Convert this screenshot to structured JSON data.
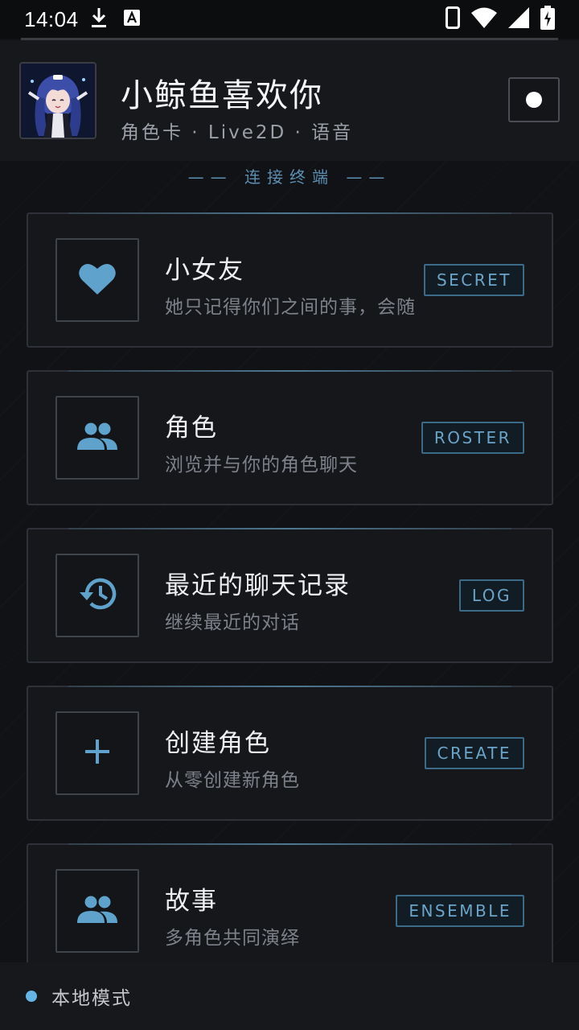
{
  "status_bar": {
    "time": "14:04",
    "left_icons": [
      "download-icon",
      "text-a-icon"
    ],
    "right_icons": [
      "phone-icon",
      "wifi-icon",
      "signal-icon",
      "battery-charging-icon"
    ]
  },
  "header": {
    "title": "小鲸鱼喜欢你",
    "subtitle": "角色卡 · Live2D · 语音"
  },
  "section_label": "—— 连接终端 ——",
  "cards": [
    {
      "icon": "heart-icon",
      "title": "小女友",
      "desc": "她只记得你们之间的事，会随",
      "badge": "SECRET"
    },
    {
      "icon": "people-icon",
      "title": "角色",
      "desc": "浏览并与你的角色聊天",
      "badge": "ROSTER"
    },
    {
      "icon": "history-icon",
      "title": "最近的聊天记录",
      "desc": "继续最近的对话",
      "badge": "LOG"
    },
    {
      "icon": "plus-icon",
      "title": "创建角色",
      "desc": "从零创建新角色",
      "badge": "CREATE"
    },
    {
      "icon": "people-icon",
      "title": "故事",
      "desc": "多角色共同演绎",
      "badge": "ENSEMBLE"
    }
  ],
  "footer": {
    "mode_label": "本地模式"
  },
  "colors": {
    "accent": "#5fa3cc",
    "background": "#111215",
    "card": "#16171b"
  }
}
